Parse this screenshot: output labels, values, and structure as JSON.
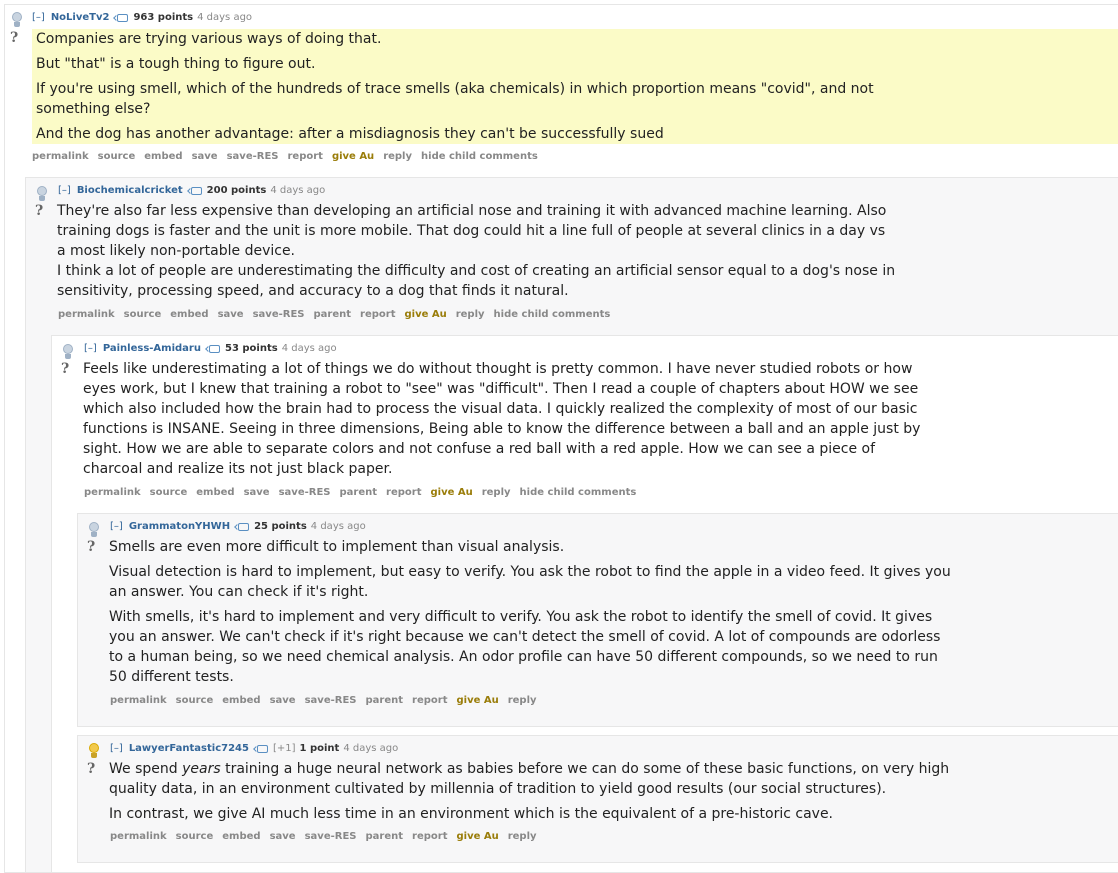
{
  "comments": [
    {
      "expand": "[–]",
      "author": "NoLiveTv2",
      "points": "963 points",
      "time": "4 days ago",
      "paragraphs": [
        "Companies are trying various ways of doing that.",
        "But \"that\" is a tough thing to figure out.",
        "If you're using smell, which of the hundreds of trace smells (aka chemicals) in which proportion means \"covid\", and not something else?",
        "And the dog has another advantage: after a misdiagnosis they can't be successfully sued"
      ],
      "buttons": [
        "permalink",
        "source",
        "embed",
        "save",
        "save-RES",
        "report",
        "give Au",
        "reply",
        "hide child comments"
      ]
    },
    {
      "expand": "[–]",
      "author": "Biochemicalcricket",
      "points": "200 points",
      "time": "4 days ago",
      "paragraphs": [
        "They're also far less expensive than developing an artificial nose and training it with advanced machine learning. Also training dogs is faster and the unit is more mobile. That dog could hit a line full of people at several clinics in a day vs a most likely non-portable device.",
        "I think a lot of people are underestimating the difficulty and cost of creating an artificial sensor equal to a dog's nose in sensitivity, processing speed, and accuracy to a dog that finds it natural."
      ],
      "buttons": [
        "permalink",
        "source",
        "embed",
        "save",
        "save-RES",
        "parent",
        "report",
        "give Au",
        "reply",
        "hide child comments"
      ]
    },
    {
      "expand": "[–]",
      "author": "Painless-Amidaru",
      "points": "53 points",
      "time": "4 days ago",
      "paragraphs": [
        "Feels like underestimating a lot of things we do without thought is pretty common. I have never studied robots or how eyes work, but I knew that training a robot to \"see\" was \"difficult\". Then I read a couple of chapters about HOW we see which also included how the brain had to process the visual data. I quickly realized the complexity of most of our basic functions is INSANE. Seeing in three dimensions, Being able to know the difference between a ball and an apple just by sight. How we are able to separate colors and not confuse a red ball with a red apple. How we can see a piece of charcoal and realize its not just black paper."
      ],
      "buttons": [
        "permalink",
        "source",
        "embed",
        "save",
        "save-RES",
        "parent",
        "report",
        "give Au",
        "reply",
        "hide child comments"
      ]
    },
    {
      "expand": "[–]",
      "author": "GrammatonYHWH",
      "points": "25 points",
      "time": "4 days ago",
      "paragraphs": [
        "Smells are even more difficult to implement than visual analysis.",
        "Visual detection is hard to implement, but easy to verify. You ask the robot to find the apple in a video feed. It gives you an answer. You can check if it's right.",
        "With smells, it's hard to implement and very difficult to verify. You ask the robot to identify the smell of covid. It gives you an answer. We can't check if it's right because we can't detect the smell of covid. A lot of compounds are odorless to a human being, so we need chemical analysis. An odor profile can have 50 different compounds, so we need to run 50 different tests."
      ],
      "buttons": [
        "permalink",
        "source",
        "embed",
        "save",
        "save-RES",
        "parent",
        "report",
        "give Au",
        "reply"
      ]
    },
    {
      "expand": "[–]",
      "author": "LawyerFantastic7245",
      "flair": "[+1]",
      "points": "1 point",
      "time": "4 days ago",
      "paragraphs": [
        "We spend years training a huge neural network as babies before we can do some of these basic functions, on very high quality data, in an environment cultivated by millennia of tradition to yield good results (our social structures).",
        "In contrast, we give AI much less time in an environment which is the equivalent of a pre-historic cave."
      ],
      "buttons": [
        "permalink",
        "source",
        "embed",
        "save",
        "save-RES",
        "parent",
        "report",
        "give Au",
        "reply"
      ]
    }
  ]
}
